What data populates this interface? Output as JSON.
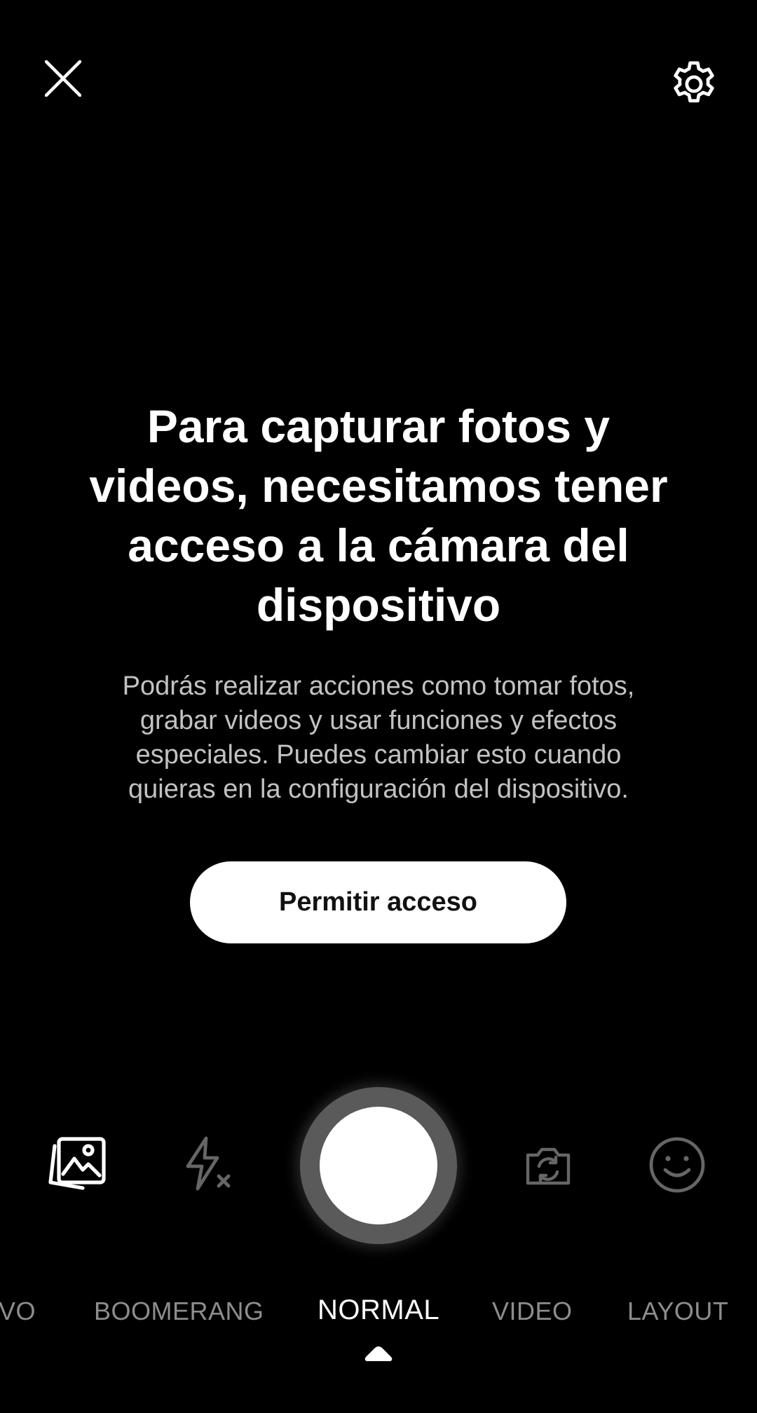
{
  "permission": {
    "headline": "Para capturar fotos y videos, necesitamos tener acceso a la cámara del dispositivo",
    "description": "Podrás realizar acciones como tomar fotos, grabar videos y usar funciones y efectos especiales. Puedes cambiar esto cuando quieras en la configuración del dispositivo.",
    "allow_button": "Permitir acceso"
  },
  "top_bar": {
    "close_icon": "close-icon",
    "settings_icon": "gear-icon"
  },
  "controls": {
    "gallery_icon": "gallery-icon",
    "flash_icon": "flash-off-icon",
    "shutter": "shutter-button",
    "flip_icon": "camera-flip-icon",
    "effects_icon": "smiley-icon"
  },
  "modes": {
    "items": [
      "VO",
      "BOOMERANG",
      "NORMAL",
      "VIDEO",
      "LAYOUT"
    ],
    "selected": "NORMAL"
  },
  "colors": {
    "background": "#000000",
    "primary_text": "#ffffff",
    "secondary_text": "#c2c2c2",
    "inactive_mode": "#8d8d8d",
    "disabled_icon": "#666666"
  }
}
